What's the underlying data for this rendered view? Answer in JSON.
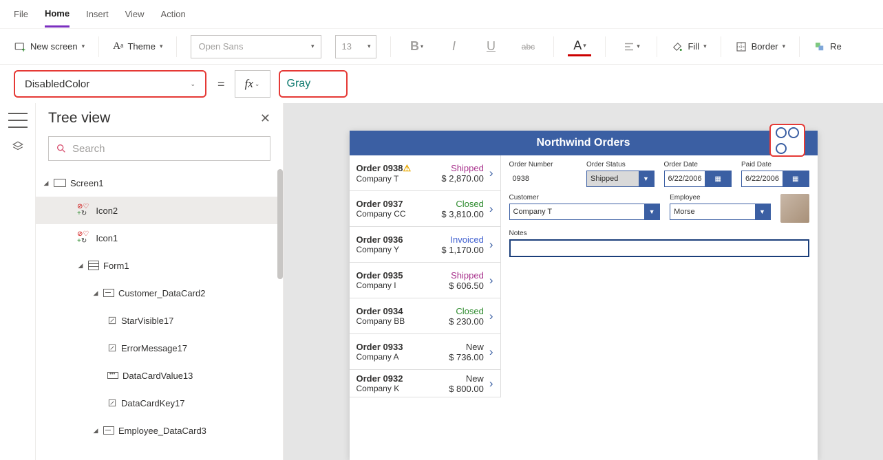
{
  "menu": {
    "file": "File",
    "home": "Home",
    "insert": "Insert",
    "view": "View",
    "action": "Action"
  },
  "ribbon": {
    "newScreen": "New screen",
    "theme": "Theme",
    "font": "Open Sans",
    "fontSize": "13",
    "bold": "B",
    "italic": "I",
    "underline": "U",
    "strike": "abc",
    "fill": "Fill",
    "border": "Border",
    "reorder": "Re"
  },
  "formula": {
    "property": "DisabledColor",
    "equals": "=",
    "fx": "fx",
    "value": "Gray"
  },
  "tree": {
    "title": "Tree view",
    "searchPlaceholder": "Search",
    "nodes": {
      "screen1": "Screen1",
      "icon2": "Icon2",
      "icon1": "Icon1",
      "form1": "Form1",
      "custCard": "Customer_DataCard2",
      "starVisible": "StarVisible17",
      "errorMsg": "ErrorMessage17",
      "dcv": "DataCardValue13",
      "dcKey": "DataCardKey17",
      "empCard": "Employee_DataCard3"
    }
  },
  "app": {
    "title": "Northwind Orders",
    "orders": [
      {
        "id": "Order 0938",
        "company": "Company T",
        "status": "Shipped",
        "statusClass": "shipped",
        "amount": "$ 2,870.00",
        "warn": true
      },
      {
        "id": "Order 0937",
        "company": "Company CC",
        "status": "Closed",
        "statusClass": "closed",
        "amount": "$ 3,810.00"
      },
      {
        "id": "Order 0936",
        "company": "Company Y",
        "status": "Invoiced",
        "statusClass": "invoiced",
        "amount": "$ 1,170.00"
      },
      {
        "id": "Order 0935",
        "company": "Company I",
        "status": "Shipped",
        "statusClass": "shipped",
        "amount": "$ 606.50"
      },
      {
        "id": "Order 0934",
        "company": "Company BB",
        "status": "Closed",
        "statusClass": "closed",
        "amount": "$ 230.00"
      },
      {
        "id": "Order 0933",
        "company": "Company A",
        "status": "New",
        "statusClass": "new",
        "amount": "$ 736.00"
      },
      {
        "id": "Order 0932",
        "company": "Company K",
        "status": "New",
        "statusClass": "new",
        "amount": "$ 800.00"
      }
    ],
    "detail": {
      "orderNumberLabel": "Order Number",
      "orderNumber": "0938",
      "orderStatusLabel": "Order Status",
      "orderStatus": "Shipped",
      "orderDateLabel": "Order Date",
      "orderDate": "6/22/2006",
      "paidDateLabel": "Paid Date",
      "paidDate": "6/22/2006",
      "customerLabel": "Customer",
      "customer": "Company T",
      "employeeLabel": "Employee",
      "employee": "Morse",
      "notesLabel": "Notes"
    }
  }
}
